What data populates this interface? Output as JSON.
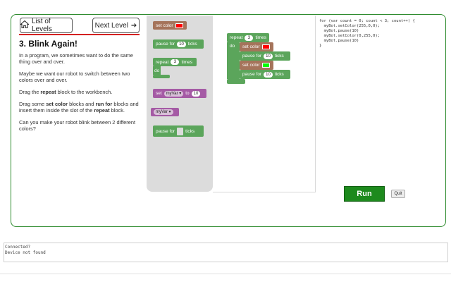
{
  "nav": {
    "list_levels": "List of Levels",
    "next_level": "Next Level",
    "next_arrow": "➔"
  },
  "lesson": {
    "title": "3. Blink Again!",
    "p1": "In a program, we sometimes want to do the same thing over and over.",
    "p2": "Maybe we want our robot to switch between two colors over and over.",
    "p3_a": "Drag the ",
    "p3_b": "repeat",
    "p3_c": " block to the workbench.",
    "p4_a": "Drag some ",
    "p4_b": "set color",
    "p4_c": " blocks and ",
    "p4_d": "run for",
    "p4_e": " blocks and insert them inside the slot of the ",
    "p4_f": "repeat",
    "p4_g": " block.",
    "p5": "Can you make your robot blink between 2 different colors?"
  },
  "toolbox": {
    "set_color": "set color",
    "set_color_value": "#ff0000",
    "pause_for": "pause for",
    "pause_value": "10",
    "ticks": "ticks",
    "repeat": "repeat",
    "repeat_value": "3",
    "times": "times",
    "do": "do",
    "set": "set",
    "var_name": "myVar ▾",
    "to": "to",
    "set_value": "10",
    "var_get": "myVar ▾",
    "pause_for2": "pause for",
    "ticks2": "ticks"
  },
  "workspace": {
    "repeat": "repeat",
    "repeat_value": "3",
    "times": "times",
    "do": "do",
    "set_color1": "set color",
    "color1": "#ff0000",
    "pause1": "pause for",
    "pause1_value": "10",
    "ticks1": "ticks",
    "set_color2": "set color",
    "color2": "#00ff00",
    "pause2": "pause for",
    "pause2_value": "10",
    "ticks2": "ticks"
  },
  "code": {
    "text": "for (var count = 0; count < 3; count++) {\n  myBot.setColor(255,0,0);\n  myBot.pause(10)\n  myBot.setColor(0,255,0);\n  myBot.pause(10)\n}"
  },
  "controls": {
    "run": "Run",
    "quit": "Quit"
  },
  "console": {
    "line1": "Connected?",
    "line2": "Device not found"
  },
  "colors": {
    "accent_green": "#2e8b2e",
    "run_green": "#1d8a1d",
    "block_green": "#5ba55b",
    "block_brown": "#a5745b",
    "block_purple": "#a55ba5",
    "rule_red": "#d32020"
  },
  "icons": {
    "home": "home-icon",
    "arrow": "arrow-right-icon"
  }
}
